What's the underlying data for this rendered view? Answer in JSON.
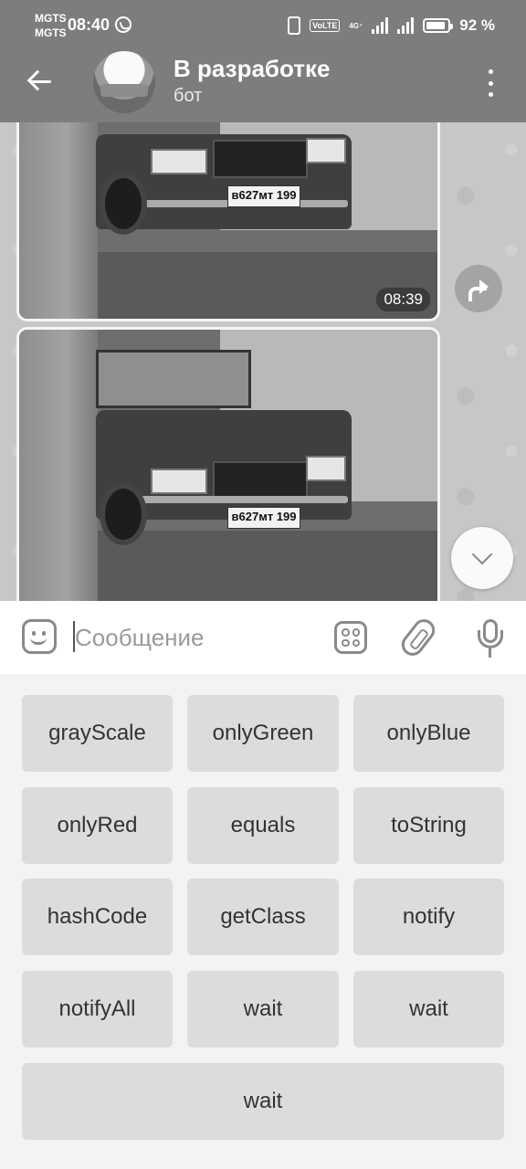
{
  "status_bar": {
    "carrier_1": "MGTS",
    "carrier_2": "MGTS",
    "time": "08:40",
    "volte": "VoLTE",
    "network": "4G⁺",
    "battery": "92 %",
    "battery_level": 0.92,
    "icons": [
      "whatsapp-icon",
      "vibrate-icon",
      "volte-icon",
      "signal-icon",
      "battery-icon"
    ]
  },
  "header": {
    "title": "В разработке",
    "subtitle": "бот",
    "icons": [
      "back-arrow-icon",
      "more-vertical-icon"
    ]
  },
  "messages": [
    {
      "type": "photo",
      "time": "08:39",
      "plate": "в627мт 199"
    },
    {
      "type": "photo",
      "plate": "в627мт 199"
    }
  ],
  "composer": {
    "placeholder": "Сообщение",
    "icons": [
      "emoji-icon",
      "apps-icon",
      "attach-icon",
      "mic-icon"
    ]
  },
  "bot_keyboard": {
    "rows": [
      [
        "grayScale",
        "onlyGreen",
        "onlyBlue"
      ],
      [
        "onlyRed",
        "equals",
        "toString"
      ],
      [
        "hashCode",
        "getClass",
        "notify"
      ],
      [
        "notifyAll",
        "wait",
        "wait"
      ],
      [
        "wait"
      ]
    ]
  },
  "colors": {
    "header_bg": "#7d7d7d",
    "chat_bg": "#c7c7c7",
    "keyboard_bg": "#f3f3f3",
    "key_bg": "#dcdcdc"
  }
}
